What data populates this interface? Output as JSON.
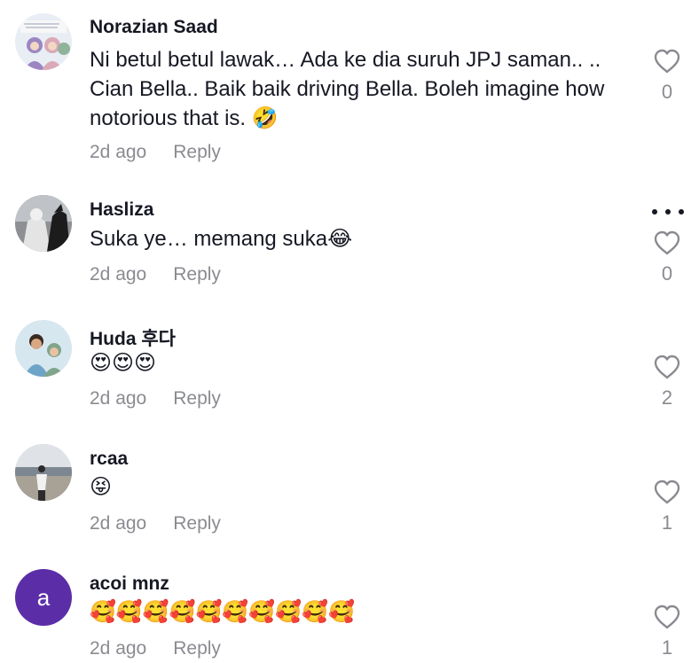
{
  "comments": [
    {
      "username": "Norazian Saad",
      "text": "Ni betul betul lawak… Ada ke dia suruh JPJ saman.. .. Cian Bella.. Baik baik driving Bella. Boleh imagine how notorious that is. 🤣",
      "time": "2d ago",
      "reply": "Reply",
      "likes": "0"
    },
    {
      "username": "Hasliza",
      "text": "Suka ye… memang suka😂",
      "time": "2d ago",
      "reply": "Reply",
      "likes": "0"
    },
    {
      "username": "Huda 후다",
      "text": "😍😍😍",
      "time": "2d ago",
      "reply": "Reply",
      "likes": "2"
    },
    {
      "username": "rcaa",
      "text": "😝",
      "time": "2d ago",
      "reply": "Reply",
      "likes": "1"
    },
    {
      "username": "acoi mnz",
      "avatar_letter": "a",
      "text": "🥰🥰🥰🥰🥰🥰🥰🥰🥰🥰",
      "time": "2d ago",
      "reply": "Reply",
      "likes": "1"
    }
  ],
  "icons": {
    "like": "heart-outline-icon",
    "more": "more-horizontal-icon"
  },
  "colors": {
    "text": "#161823",
    "muted": "#8a8b91",
    "avatar_purple": "#5b2ea8"
  }
}
